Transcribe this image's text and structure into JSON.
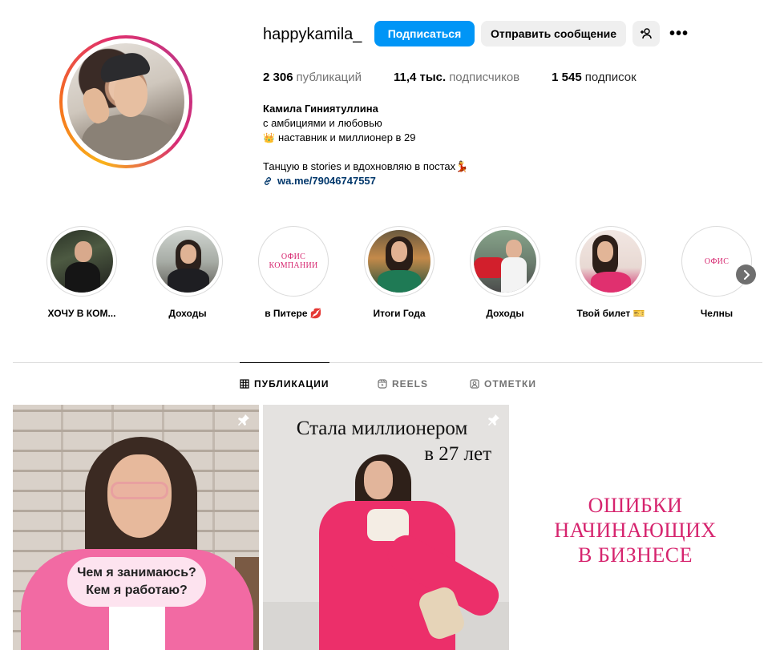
{
  "profile": {
    "username": "happykamila_",
    "follow_label": "Подписаться",
    "message_label": "Отправить сообщение",
    "more_label": "•••"
  },
  "stats": {
    "posts_count": "2 306",
    "posts_label": "публикаций",
    "followers_count": "11,4 тыс.",
    "followers_label": "подписчиков",
    "following_count": "1 545",
    "following_label": "подписок"
  },
  "bio": {
    "name": "Камила Гиниятуллина",
    "line1": "с амбициями и любовью",
    "line2_emoji": "👑",
    "line2": "наставник и миллионер в 29",
    "line3": "Танцую в stories и вдохновляю в постах💃",
    "link": "wa.me/79046747557"
  },
  "highlights": [
    {
      "label": "ХОЧУ В КОМ..."
    },
    {
      "label": "Доходы"
    },
    {
      "label": "в Питере 💋",
      "cover_text": "ОФИС\nКОМПАНИИ"
    },
    {
      "label": "Итоги Года"
    },
    {
      "label": "Доходы"
    },
    {
      "label": "Твой билет 🎫"
    },
    {
      "label": "Челны",
      "cover_text": "ОФИС"
    }
  ],
  "tabs": [
    {
      "label": "ПУБЛИКАЦИИ",
      "active": true
    },
    {
      "label": "REELS",
      "active": false
    },
    {
      "label": "ОТМЕТКИ",
      "active": false
    }
  ],
  "posts": [
    {
      "bubble_line1": "Чем я занимаюсь?",
      "bubble_line2": "Кем я работаю?",
      "pinned": true
    },
    {
      "title_line1": "Стала миллионером",
      "title_line2": "в 27 лет",
      "pinned": true
    },
    {
      "line1": "ОШИБКИ",
      "line2": "НАЧИНАЮЩИХ",
      "line3": "В БИЗНЕСЕ"
    }
  ],
  "colors": {
    "accent_blue": "#0095f6",
    "link_blue": "#00376b",
    "brand_pink": "#d6246e"
  }
}
